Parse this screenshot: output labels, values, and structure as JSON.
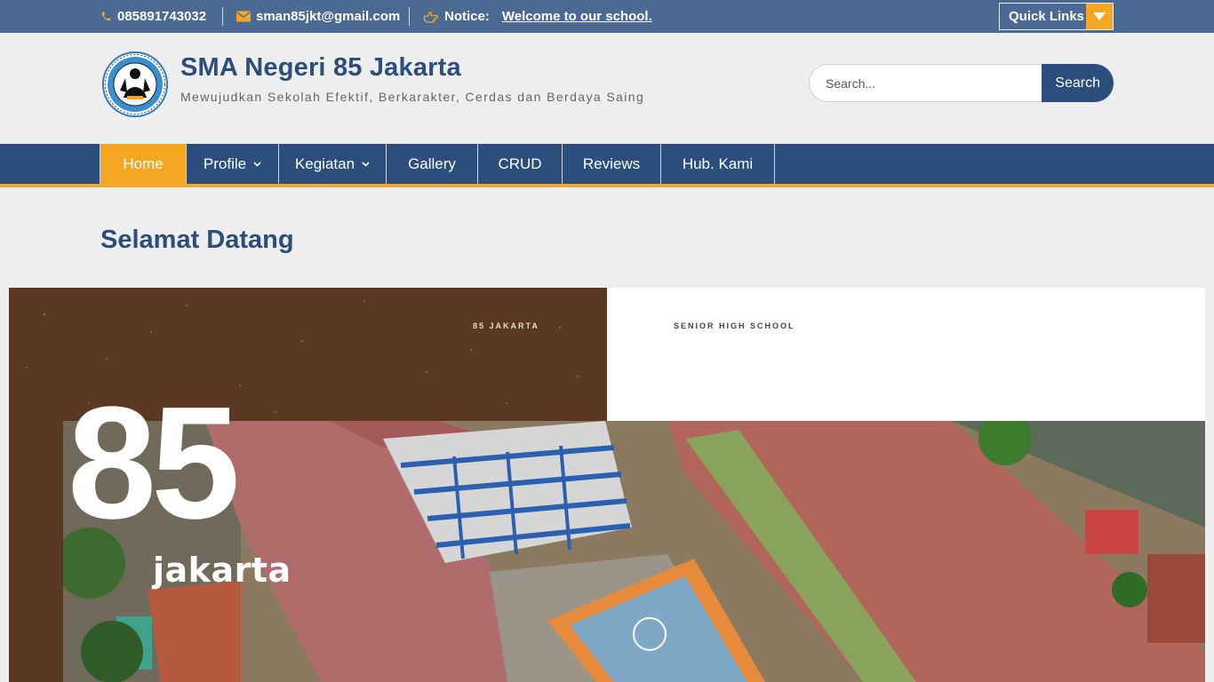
{
  "topbar": {
    "phone": "085891743032",
    "email": "sman85jkt@gmail.com",
    "notice_label": "Notice:",
    "notice_text": "Welcome to our school.",
    "quick_links_label": "Quick Links"
  },
  "header": {
    "site_title": "SMA Negeri 85 Jakarta",
    "tagline": "Mewujudkan Sekolah Efektif, Berkarakter, Cerdas dan Berdaya Saing"
  },
  "search": {
    "placeholder": "Search...",
    "button_label": "Search"
  },
  "nav": {
    "items": [
      {
        "label": "Home",
        "active": true
      },
      {
        "label": "Profile",
        "has_dropdown": true
      },
      {
        "label": "Kegiatan",
        "has_dropdown": true
      },
      {
        "label": "Gallery"
      },
      {
        "label": "CRUD"
      },
      {
        "label": "Reviews"
      },
      {
        "label": "Hub. Kami"
      }
    ]
  },
  "main": {
    "page_title": "Selamat Datang"
  },
  "banner": {
    "small_left": "85 JAKARTA",
    "small_right": "SENIOR HIGH SCHOOL",
    "big_number": "85",
    "city": "jakarta"
  },
  "colors": {
    "topbar": "#4a6a93",
    "primary": "#2c4e7c",
    "accent": "#f5a623",
    "banner_brown": "#5b3822"
  },
  "icons": [
    "phone-icon",
    "envelope-icon",
    "hand-pointer-icon",
    "chevron-down-icon",
    "search-icon"
  ]
}
